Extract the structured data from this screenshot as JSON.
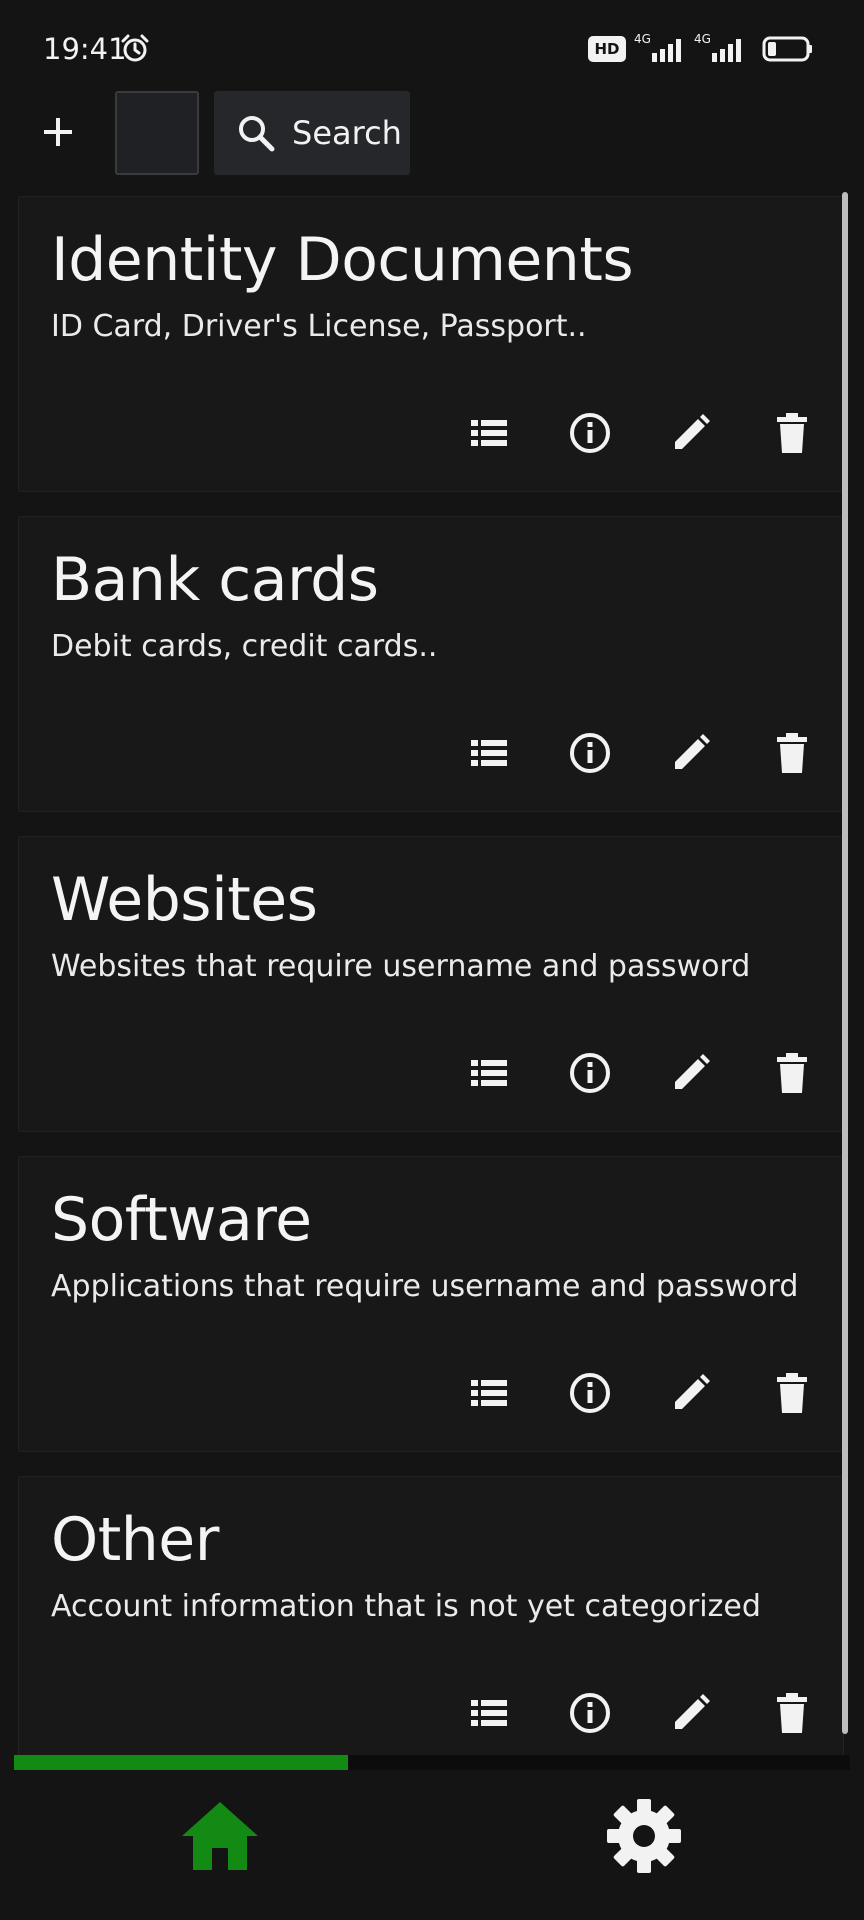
{
  "status_bar": {
    "time": "19:41",
    "hd_badge": "HD",
    "net1": "4G",
    "net2": "4G",
    "icons": [
      "alarm-icon",
      "signal-icon",
      "battery-icon"
    ]
  },
  "toolbar": {
    "add_icon": "plus-icon",
    "search_label": "Search",
    "search_icon": "search-icon"
  },
  "categories": [
    {
      "title": "Identity Documents",
      "description": "ID Card, Driver's License, Passport.."
    },
    {
      "title": "Bank cards",
      "description": "Debit cards, credit cards.."
    },
    {
      "title": "Websites",
      "description": "Websites that require username and password"
    },
    {
      "title": "Software",
      "description": "Applications that require username and password"
    },
    {
      "title": "Other",
      "description": "Account information that is not yet categorized"
    }
  ],
  "card_actions": [
    "list-icon",
    "info-icon",
    "edit-icon",
    "delete-icon"
  ],
  "progress": {
    "value": 0.4
  },
  "bottom_nav": {
    "items": [
      "home-icon",
      "settings-icon"
    ],
    "active": "home"
  },
  "colors": {
    "background": "#141414",
    "card": "#181818",
    "accent": "#138a13",
    "text": "#f2f2f2"
  }
}
